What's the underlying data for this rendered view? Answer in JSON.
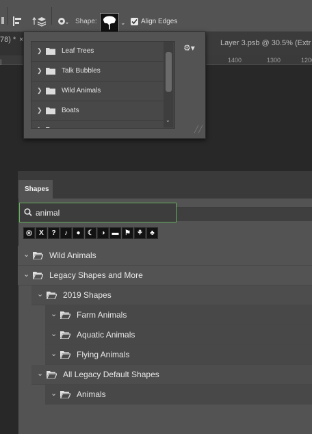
{
  "options_bar": {
    "shapes_label": "Shape:",
    "align_edges_label": "Align Edges",
    "align_edges_checked": true
  },
  "document": {
    "left_tab_fragment": "78) *",
    "close_glyph": "×",
    "doc_tab_title": "Layer 3.psb @ 30.5% (Extr",
    "ruler_numbers": [
      "1400",
      "1300",
      "1200"
    ]
  },
  "shape_picker": {
    "items": [
      {
        "label": "Leaf Trees"
      },
      {
        "label": "Talk Bubbles"
      },
      {
        "label": "Wild Animals"
      },
      {
        "label": "Boats"
      }
    ]
  },
  "shapes_panel": {
    "tab_label": "Shapes",
    "search": {
      "value": "animal",
      "placeholder": ""
    },
    "tree": [
      {
        "label": "Wild Animals",
        "level": 0
      },
      {
        "label": "Legacy Shapes and More",
        "level": 0
      },
      {
        "label": "2019 Shapes",
        "level": 1
      },
      {
        "label": "Farm Animals",
        "level": 2
      },
      {
        "label": "Aquatic Animals",
        "level": 2
      },
      {
        "label": "Flying Animals",
        "level": 2
      },
      {
        "label": "All Legacy Default Shapes",
        "level": 1
      },
      {
        "label": "Animals",
        "level": 2
      }
    ]
  },
  "colors": {
    "search_focus": "#62b25a",
    "panel_bg": "#535353"
  }
}
